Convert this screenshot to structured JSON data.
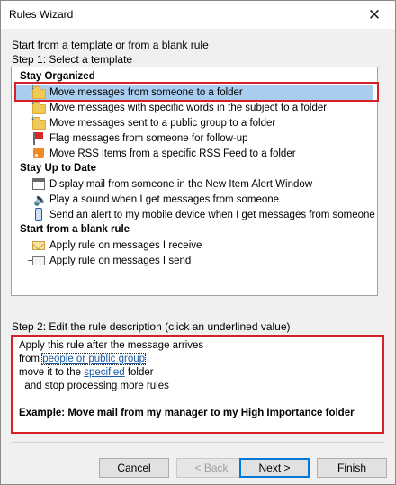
{
  "window": {
    "title": "Rules Wizard",
    "close_glyph": "✕"
  },
  "intro": "Start from a template or from a blank rule",
  "step1_label": "Step 1: Select a template",
  "groups": [
    {
      "heading": "Stay Organized",
      "items": [
        {
          "label": "Move messages from someone to a folder",
          "icon": "folder-arrow-icon",
          "selected": true
        },
        {
          "label": "Move messages with specific words in the subject to a folder",
          "icon": "folder-arrow-icon"
        },
        {
          "label": "Move messages sent to a public group to a folder",
          "icon": "folder-arrow-icon"
        },
        {
          "label": "Flag messages from someone for follow-up",
          "icon": "flag-icon"
        },
        {
          "label": "Move RSS items from a specific RSS Feed to a folder",
          "icon": "rss-icon"
        }
      ]
    },
    {
      "heading": "Stay Up to Date",
      "items": [
        {
          "label": "Display mail from someone in the New Item Alert Window",
          "icon": "window-icon"
        },
        {
          "label": "Play a sound when I get messages from someone",
          "icon": "speaker-icon"
        },
        {
          "label": "Send an alert to my mobile device when I get messages from someone",
          "icon": "phone-icon"
        }
      ]
    },
    {
      "heading": "Start from a blank rule",
      "items": [
        {
          "label": "Apply rule on messages I receive",
          "icon": "envelope-icon"
        },
        {
          "label": "Apply rule on messages I send",
          "icon": "envelope-send-icon"
        }
      ]
    }
  ],
  "step2_label": "Step 2: Edit the rule description (click an underlined value)",
  "description": {
    "line1": "Apply this rule after the message arrives",
    "line2_prefix": "from ",
    "line2_link": "people or public group",
    "line3_prefix": "move it to the ",
    "line3_link": "specified",
    "line3_suffix": " folder",
    "line4": "  and stop processing more rules",
    "example": "Example: Move mail from my manager to my High Importance folder"
  },
  "buttons": {
    "cancel": "Cancel",
    "back": "< Back",
    "next": "Next >",
    "finish": "Finish"
  },
  "colors": {
    "selection": "#a9cdef",
    "highlight_outline": "#d61f26",
    "link": "#1a5ba6"
  }
}
